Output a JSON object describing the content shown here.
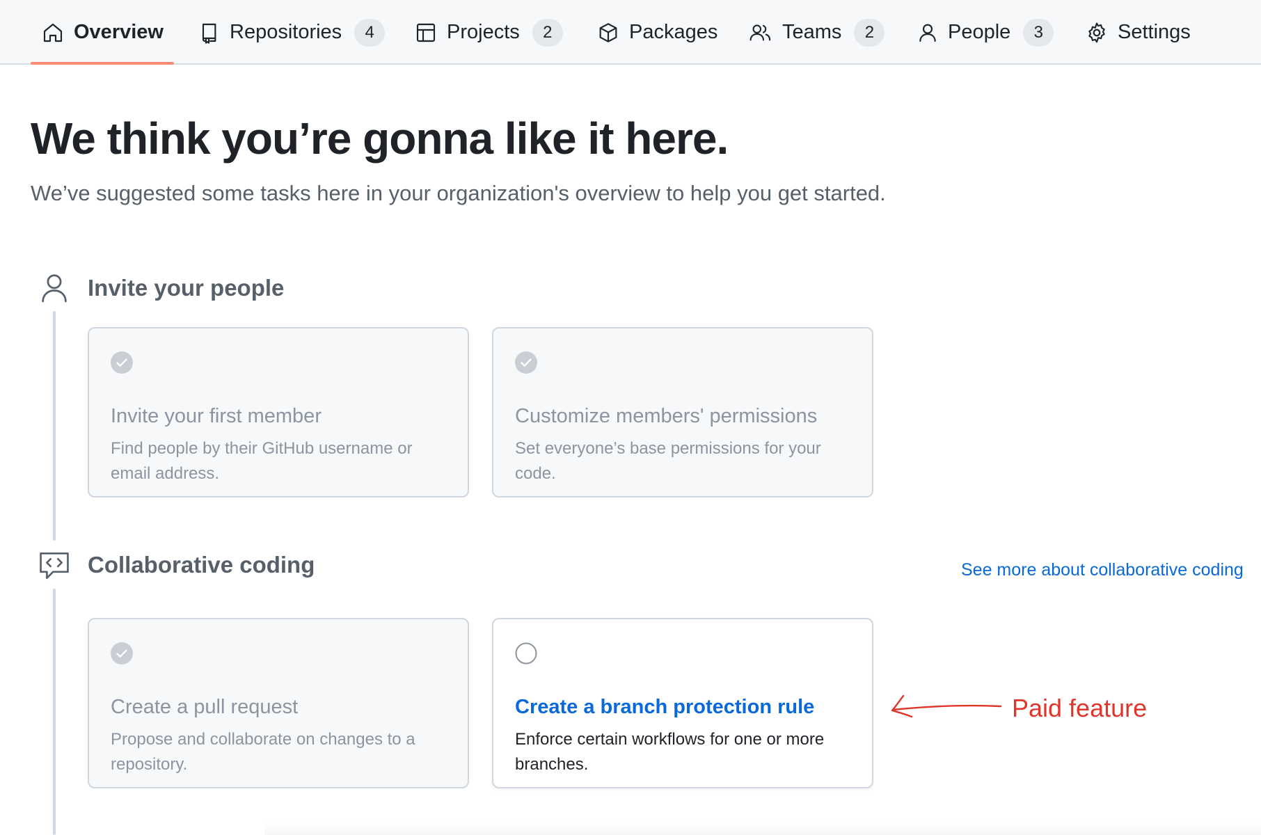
{
  "nav": {
    "items": [
      {
        "label": "Overview",
        "icon": "home-icon",
        "active": true
      },
      {
        "label": "Repositories",
        "icon": "repo-icon",
        "count": "4"
      },
      {
        "label": "Projects",
        "icon": "table-icon",
        "count": "2"
      },
      {
        "label": "Packages",
        "icon": "package-icon"
      },
      {
        "label": "Teams",
        "icon": "people-icon",
        "count": "2"
      },
      {
        "label": "People",
        "icon": "person-icon",
        "count": "3"
      },
      {
        "label": "Settings",
        "icon": "gear-icon"
      }
    ]
  },
  "hero": {
    "title": "We think you’re gonna like it here.",
    "subtitle": "We’ve suggested some tasks here in your organization's overview to help you get started."
  },
  "sections": [
    {
      "title": "Invite your people",
      "icon": "person-icon",
      "cards": [
        {
          "title": "Invite your first member",
          "description": "Find people by their GitHub username or email address.",
          "completed": true
        },
        {
          "title": "Customize members' permissions",
          "description": "Set everyone’s base permissions for your code.",
          "completed": true
        }
      ]
    },
    {
      "title": "Collaborative coding",
      "icon": "code-review-icon",
      "link": "See more about collaborative coding",
      "cards": [
        {
          "title": "Create a pull request",
          "description": "Propose and collaborate on changes to a repository.",
          "completed": true
        },
        {
          "title": "Create a branch protection rule",
          "description": "Enforce certain workflows for one or more branches.",
          "completed": false
        }
      ]
    }
  ],
  "annotation": {
    "text": "Paid feature",
    "color": "#e0352b"
  },
  "colors": {
    "accent": "#0969da",
    "active_tab_underline": "#fd8c73",
    "annotation": "#e0352b"
  }
}
